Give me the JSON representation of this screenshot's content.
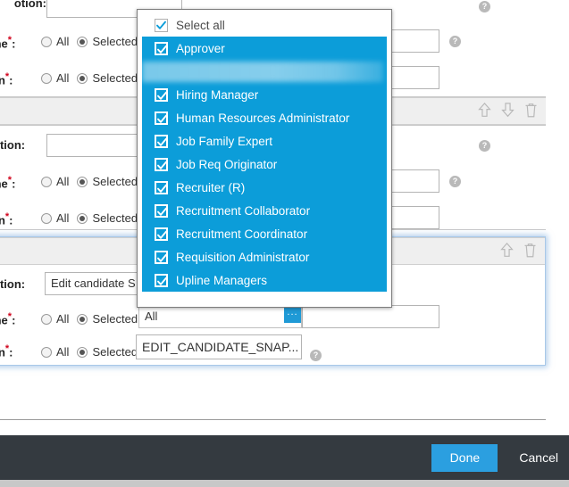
{
  "dropdown": {
    "select_all_label": "Select all",
    "items": [
      {
        "label": "Select all",
        "checked": true,
        "selected": false,
        "blurred": false
      },
      {
        "label": "Approver",
        "checked": true,
        "selected": true,
        "blurred": false
      },
      {
        "label": "",
        "checked": true,
        "selected": true,
        "blurred": true
      },
      {
        "label": "Hiring Manager",
        "checked": true,
        "selected": true,
        "blurred": false
      },
      {
        "label": "Human Resources Administrator",
        "checked": true,
        "selected": true,
        "blurred": false
      },
      {
        "label": "Job Family Expert",
        "checked": true,
        "selected": true,
        "blurred": false
      },
      {
        "label": "Job Req Originator",
        "checked": true,
        "selected": true,
        "blurred": false
      },
      {
        "label": "Recruiter (R)",
        "checked": true,
        "selected": true,
        "blurred": false
      },
      {
        "label": "Recruitment Collaborator",
        "checked": true,
        "selected": true,
        "blurred": false
      },
      {
        "label": "Recruitment Coordinator",
        "checked": true,
        "selected": true,
        "blurred": false
      },
      {
        "label": "Requisition Administrator",
        "checked": true,
        "selected": true,
        "blurred": false
      },
      {
        "label": "Upline Managers",
        "checked": true,
        "selected": true,
        "blurred": false
      }
    ],
    "accent_color": "#0c9dd9"
  },
  "groups": [
    {
      "action_label": "otion:",
      "action_value": "",
      "name_label": "me",
      "name_required": "*",
      "name_colon": ":",
      "name_radio_all": "All",
      "name_radio_selected": "Selected",
      "name_value": "",
      "perm_label": "on",
      "perm_required": "*",
      "perm_colon": ":",
      "perm_radio_all": "All",
      "perm_radio_selected": "Selected",
      "perm_value": "",
      "toolbar_icons": [
        "arrow-up-icon",
        "arrow-down-icon",
        "trash-icon"
      ]
    },
    {
      "action_label": "otion:",
      "action_value": "",
      "name_label": "me",
      "name_required": "*",
      "name_colon": ":",
      "name_radio_all": "All",
      "name_radio_selected": "Selected",
      "name_value": "",
      "perm_label": "on",
      "perm_required": "*",
      "perm_colon": ":",
      "perm_radio_all": "All",
      "perm_radio_selected": "Selected",
      "perm_value": "",
      "toolbar_icons": [
        "arrow-up-icon",
        "arrow-down-icon",
        "trash-icon"
      ]
    },
    {
      "action_label": "otion:",
      "action_value": "Edit candidate S",
      "name_label": "me",
      "name_required": "*",
      "name_colon": ":",
      "name_radio_all": "All",
      "name_radio_selected": "Selected",
      "name_value": "All",
      "name_picker_label": "...",
      "perm_label": "on",
      "perm_required": "*",
      "perm_colon": ":",
      "perm_radio_all": "All",
      "perm_radio_selected": "Selected",
      "perm_value": "EDIT_CANDIDATE_SNAP...",
      "toolbar_icons": [
        "arrow-up-icon",
        "trash-icon"
      ]
    }
  ],
  "help_icon_label": "?",
  "footer": {
    "done_label": "Done",
    "cancel_label": "Cancel",
    "bar_color": "#343a40",
    "done_color": "#2b9fe0"
  }
}
